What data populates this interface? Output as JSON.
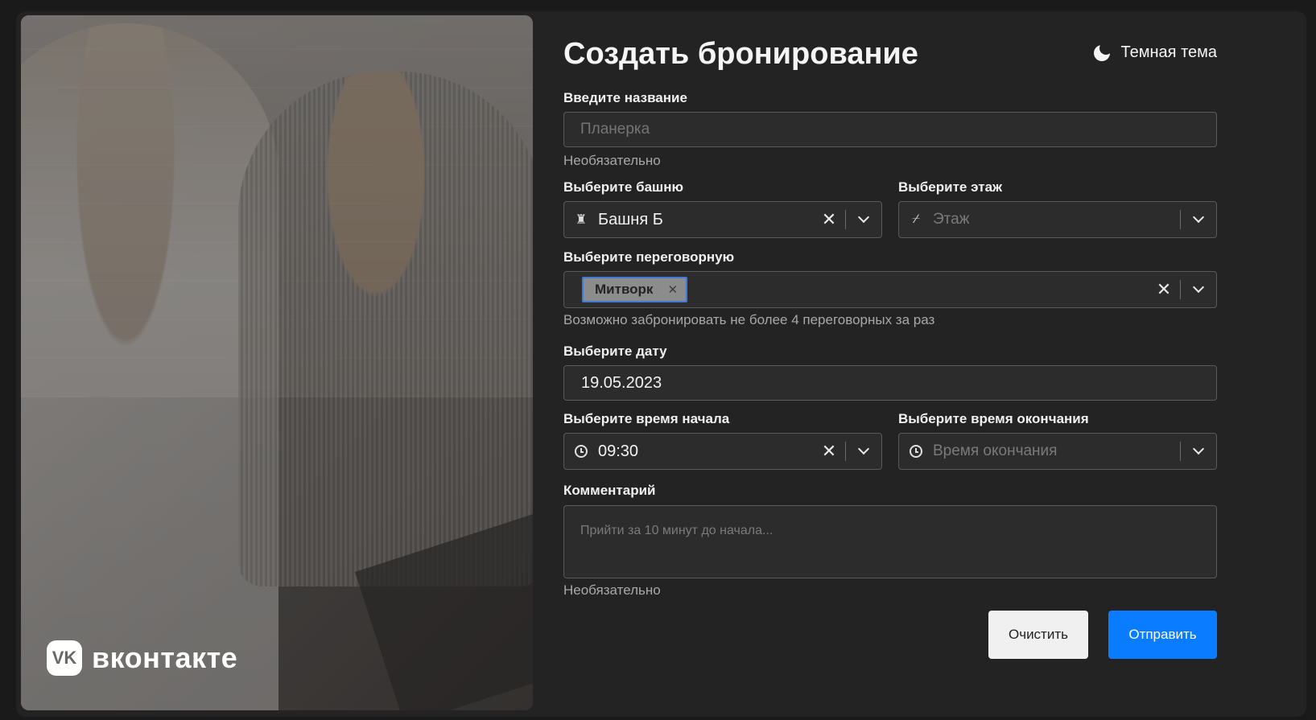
{
  "logo": {
    "mark": "VK",
    "text": "вконтакте"
  },
  "form": {
    "title": "Создать бронирование",
    "theme_toggle": {
      "label": "Темная тема",
      "icon": "moon-icon"
    },
    "name": {
      "label": "Введите название",
      "placeholder": "Планерка",
      "hint": "Необязательно"
    },
    "tower": {
      "label": "Выберите башню",
      "value": "Башня Б",
      "icon": "tower-icon"
    },
    "floor": {
      "label": "Выберите этаж",
      "placeholder": "Этаж",
      "icon": "stairs-icon"
    },
    "room": {
      "label": "Выберите переговорную",
      "selected": [
        "Митворк"
      ],
      "hint": "Возможно забронировать не более 4 переговорных за раз"
    },
    "date": {
      "label": "Выберите дату",
      "value": "19.05.2023"
    },
    "start_time": {
      "label": "Выберите время начала",
      "value": "09:30",
      "icon": "clock-icon"
    },
    "end_time": {
      "label": "Выберите время окончания",
      "placeholder": "Время окончания",
      "icon": "clock-icon"
    },
    "comment": {
      "label": "Комментарий",
      "placeholder": "Прийти за 10 минут до начала...",
      "hint": "Необязательно"
    },
    "buttons": {
      "clear": "Очистить",
      "submit": "Отправить"
    }
  },
  "colors": {
    "background": "#232323",
    "accent": "#0a7cff",
    "field": "#2c2c2c"
  }
}
